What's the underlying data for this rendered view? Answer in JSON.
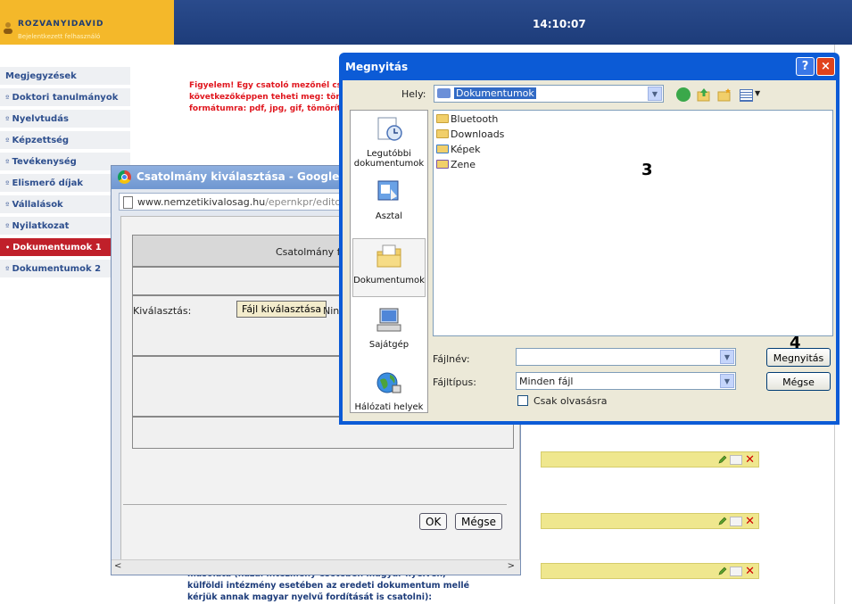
{
  "header": {
    "user_name": "ROZVANYIDAVID",
    "user_subtitle": "Bejelentkezett felhasználó",
    "clock": "14:10:07"
  },
  "menu": {
    "items": [
      {
        "label": "Megjegyzések"
      },
      {
        "label": "Doktori tanulmányok"
      },
      {
        "label": "Nyelvtudás"
      },
      {
        "label": "Képzettség"
      },
      {
        "label": "Tevékenység"
      },
      {
        "label": "Elismerő díjak"
      },
      {
        "label": "Vállalások"
      },
      {
        "label": "Nyilatkozat"
      },
      {
        "label": "Dokumentumok 1",
        "active": true
      },
      {
        "label": "Dokumentumok 2"
      }
    ]
  },
  "warning_text": "Figyelem! Egy csatoló mezőnél cs\nkövetkezőképpen teheti meg: tör\nformátumra: pdf, jpg, gif, tömörít",
  "bottom_text": "másolata (hazai intézmény esetében magyar nyelven, külföldi intézmény esetében az eredeti dokumentum mellé kérjük annak magyar nyelvű fordítását is csatolni):",
  "chrome_popup": {
    "title": "Csatolmány kiválasztása - Google Chr",
    "url_host": "www.nemzetikivalosag.hu",
    "url_path": "/epernkpr/editor/sele",
    "table_header": "Csatolmány fel",
    "select_label": "Kiválasztás:",
    "file_button": "Fájl kiválasztása",
    "no_file_text": "Ninc",
    "ok_button": "OK",
    "cancel_button": "Mégse"
  },
  "file_dialog": {
    "title": "Megnyitás",
    "help_glyph": "?",
    "close_glyph": "×",
    "location_label": "Hely:",
    "location_value": "Dokumentumok",
    "places": [
      {
        "label": "Legutóbbi dokumentumok",
        "icon": "recent-documents-icon"
      },
      {
        "label": "Asztal",
        "icon": "desktop-icon"
      },
      {
        "label": "Dokumentumok",
        "icon": "my-documents-icon",
        "selected": true
      },
      {
        "label": "Sajátgép",
        "icon": "my-computer-icon"
      },
      {
        "label": "Hálózati helyek",
        "icon": "network-places-icon"
      }
    ],
    "files": [
      {
        "name": "Bluetooth",
        "icon": "folder-icon"
      },
      {
        "name": "Downloads",
        "icon": "folder-icon"
      },
      {
        "name": "Képek",
        "icon": "pictures-folder-icon"
      },
      {
        "name": "Zene",
        "icon": "music-folder-icon"
      }
    ],
    "annotation_3": "3",
    "annotation_4": "4",
    "filename_label": "Fájlnév:",
    "filename_value": "",
    "filetype_label": "Fájltípus:",
    "filetype_value": "Minden fájl",
    "open_button": "Megnyitás",
    "cancel_button": "Mégse",
    "readonly_label": "Csak olvasásra",
    "readonly_checked": false
  },
  "colors": {
    "header_left": "#f4b82a",
    "header_right": "#1d3c7a",
    "menu_active": "#c0202a",
    "warning": "#e0161e",
    "xp_blue": "#0c5bd6",
    "dialog_bg": "#ece9d8"
  }
}
